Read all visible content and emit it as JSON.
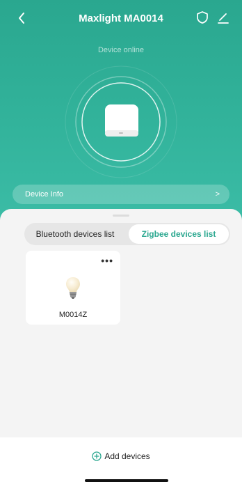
{
  "header": {
    "title": "Maxlight MA0014",
    "status": "Device online",
    "device_info_label": "Device Info",
    "accent": "#2aa78f"
  },
  "icons": {
    "back": "chevron-left-icon",
    "shield": "shield-icon",
    "edit": "edit-pencil-icon",
    "device": "hub-device-icon",
    "info_chevron": "chevron-right-icon",
    "more": "more-dots-icon",
    "bulb": "lightbulb-icon",
    "add": "plus-circle-icon"
  },
  "tabs": {
    "bluetooth": "Bluetooth devices list",
    "zigbee": "Zigbee devices list",
    "active": "zigbee"
  },
  "devices": [
    {
      "name": "M0014Z"
    }
  ],
  "footer": {
    "add_label": "Add devices"
  }
}
